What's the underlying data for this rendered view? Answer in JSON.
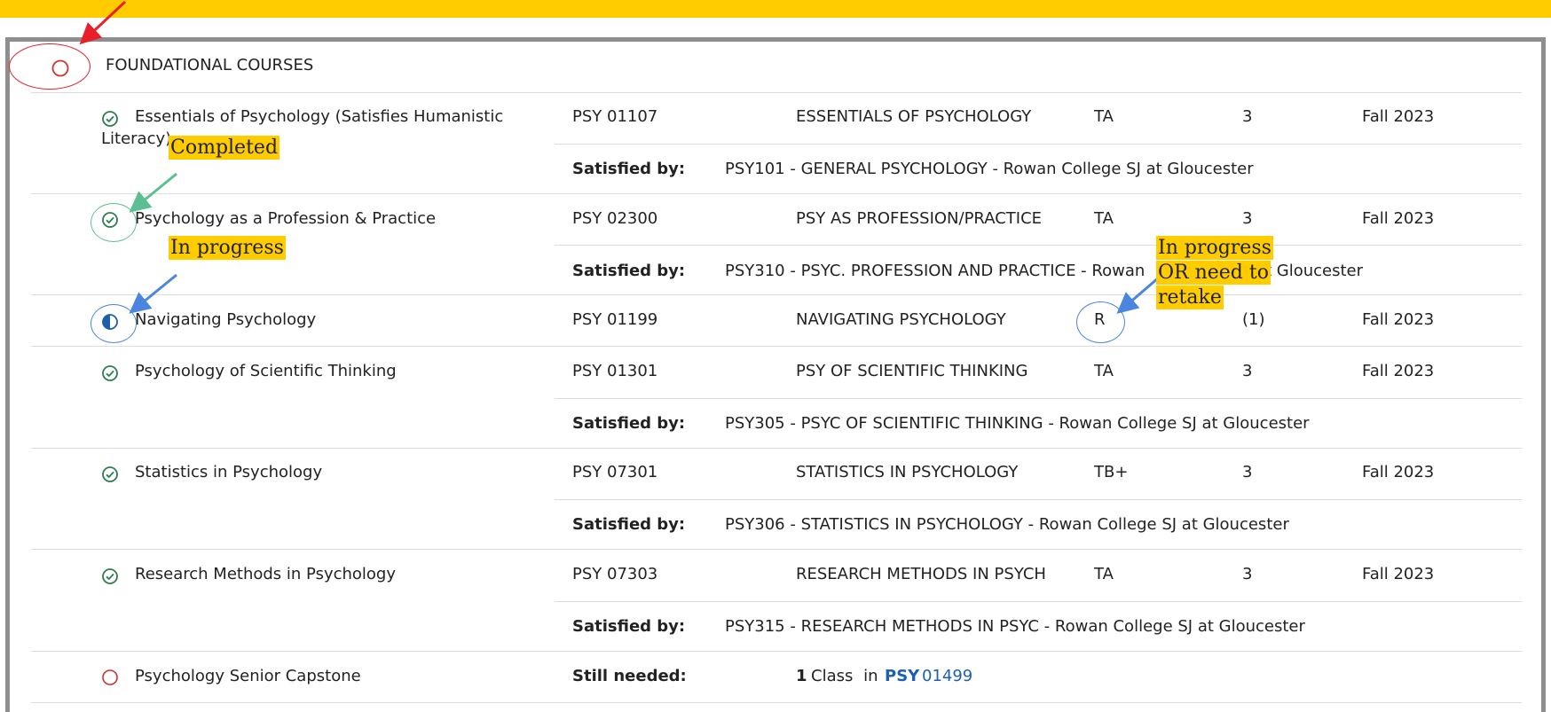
{
  "section": {
    "title": "FOUNDATIONAL COURSES",
    "status": "not-started"
  },
  "rows": [
    {
      "requirement": "Essentials of Psychology (Satisfies Humanistic",
      "requirement_cont": "Literacy)",
      "status": "completed",
      "course": "PSY 01107",
      "course_title": "ESSENTIALS OF PSYCHOLOGY",
      "grade": "TA",
      "credits": "3",
      "term": "Fall 2023",
      "satisfied_label": "Satisfied by:",
      "satisfied_text": "PSY101 - GENERAL PSYCHOLOGY - Rowan College SJ at Gloucester"
    },
    {
      "requirement": "Psychology as a Profession & Practice",
      "status": "completed",
      "course": "PSY 02300",
      "course_title": "PSY AS PROFESSION/PRACTICE",
      "grade": "TA",
      "credits": "3",
      "term": "Fall 2023",
      "satisfied_label": "Satisfied by:",
      "satisfied_text": "PSY310 - PSYC. PROFESSION AND PRACTICE - Rowan",
      "satisfied_text_tail": "t Gloucester"
    },
    {
      "requirement": "Navigating Psychology",
      "status": "in-progress",
      "course": "PSY 01199",
      "course_title": "NAVIGATING PSYCHOLOGY",
      "grade": "R",
      "credits": "(1)",
      "term": "Fall 2023"
    },
    {
      "requirement": "Psychology of Scientific Thinking",
      "status": "completed",
      "course": "PSY 01301",
      "course_title": "PSY OF SCIENTIFIC THINKING",
      "grade": "TA",
      "credits": "3",
      "term": "Fall 2023",
      "satisfied_label": "Satisfied by:",
      "satisfied_text": "PSY305 - PSYC OF SCIENTIFIC THINKING - Rowan College SJ at Gloucester"
    },
    {
      "requirement": "Statistics in Psychology",
      "status": "completed",
      "course": "PSY 07301",
      "course_title": "STATISTICS IN PSYCHOLOGY",
      "grade": "TB+",
      "credits": "3",
      "term": "Fall 2023",
      "satisfied_label": "Satisfied by:",
      "satisfied_text": "PSY306 - STATISTICS IN PSYCHOLOGY - Rowan College SJ at Gloucester"
    },
    {
      "requirement": "Research Methods in Psychology",
      "status": "completed",
      "course": "PSY 07303",
      "course_title": "RESEARCH METHODS IN PSYCH",
      "grade": "TA",
      "credits": "3",
      "term": "Fall 2023",
      "satisfied_label": "Satisfied by:",
      "satisfied_text": "PSY315 - RESEARCH METHODS IN PSYC - Rowan College SJ at Gloucester"
    },
    {
      "requirement": "Psychology Senior Capstone",
      "status": "not-started",
      "needed_label": "Still needed:",
      "needed_count": "1",
      "needed_text": "Class in",
      "needed_subject": "PSY",
      "needed_number": "01499"
    }
  ],
  "annotations": {
    "completed": "Completed",
    "in_progress": "In progress",
    "retake_line1": "In progress",
    "retake_line2": "OR need to",
    "retake_line3": "retake"
  },
  "colors": {
    "banner": "#ffcc00",
    "completed_icon": "#2e7d4f",
    "in_progress_icon": "#1d5fa8",
    "not_started_icon": "#d32f2f",
    "link": "#1c5fb3",
    "arrow_red": "#e8202a",
    "arrow_green": "#5cbf94",
    "arrow_blue": "#4a86e0"
  },
  "icons": {
    "completed": "check-circle-icon",
    "in_progress": "half-circle-icon",
    "not_started": "empty-circle-icon"
  }
}
